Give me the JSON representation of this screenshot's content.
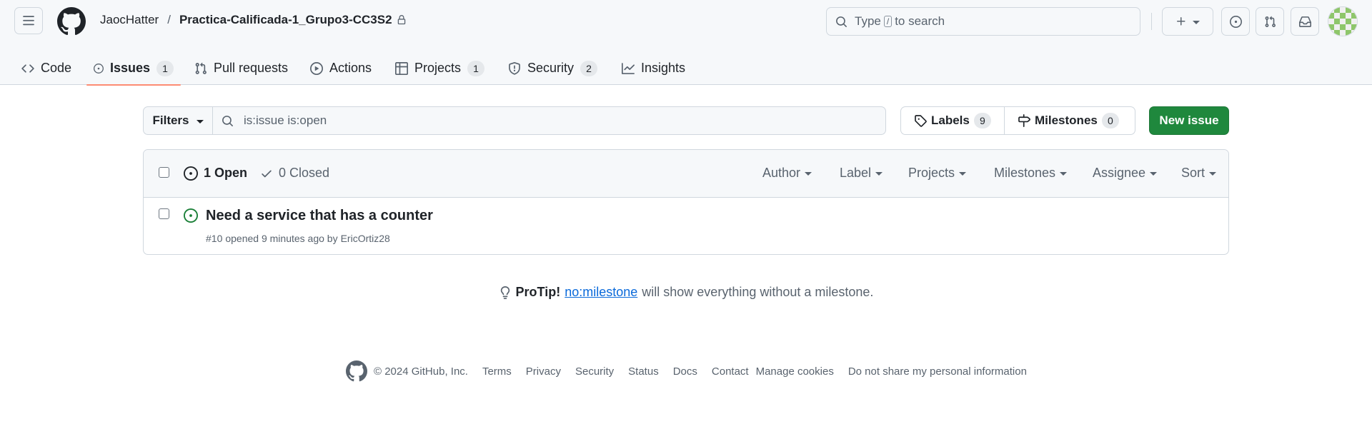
{
  "header": {
    "owner": "JaocHatter",
    "separator": "/",
    "repo": "Practica-Calificada-1_Grupo3-CC3S2",
    "search_prefix": "Type",
    "search_key": "/",
    "search_suffix": "to search"
  },
  "repo_nav": [
    {
      "label": "Code",
      "icon": "code-icon"
    },
    {
      "label": "Issues",
      "icon": "issue-opened-icon",
      "count": "1",
      "selected": true
    },
    {
      "label": "Pull requests",
      "icon": "git-pull-request-icon"
    },
    {
      "label": "Actions",
      "icon": "play-icon"
    },
    {
      "label": "Projects",
      "icon": "table-icon",
      "count": "1"
    },
    {
      "label": "Security",
      "icon": "shield-icon",
      "count": "2"
    },
    {
      "label": "Insights",
      "icon": "graph-icon"
    }
  ],
  "subnav": {
    "filters_label": "Filters",
    "query": "is:issue is:open",
    "labels_label": "Labels",
    "labels_count": "9",
    "milestones_label": "Milestones",
    "milestones_count": "0",
    "new_issue_label": "New issue"
  },
  "issues_header": {
    "open_label": "1 Open",
    "closed_label": "0 Closed",
    "filters": [
      "Author",
      "Label",
      "Projects",
      "Milestones",
      "Assignee",
      "Sort"
    ]
  },
  "issues": [
    {
      "title": "Need a service that has a counter",
      "number": "#10",
      "opened": "opened 9 minutes ago by",
      "author": "EricOrtiz28"
    }
  ],
  "protip": {
    "label": "ProTip!",
    "link": "no:milestone",
    "text": "will show everything without a milestone."
  },
  "footer": {
    "copyright": "© 2024 GitHub, Inc.",
    "links": [
      "Terms",
      "Privacy",
      "Security",
      "Status",
      "Docs",
      "Contact",
      "Manage cookies",
      "Do not share my personal information"
    ]
  },
  "colors": {
    "primary_button": "#1f883d",
    "selected_tab_underline": "#fd8c73",
    "link": "#0969da",
    "open_state": "#1a7f37"
  }
}
